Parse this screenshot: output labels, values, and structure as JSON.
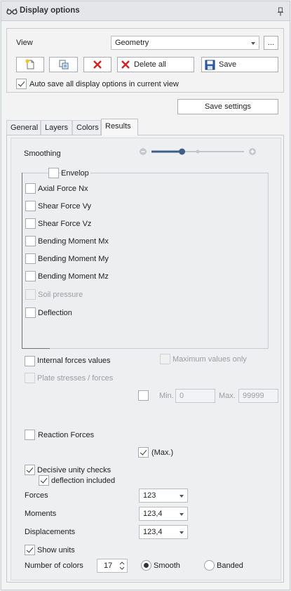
{
  "title": "Display options",
  "view": {
    "label": "View",
    "value": "Geometry",
    "more": "...",
    "buttons": {
      "delete_all": "Delete all",
      "save": "Save"
    },
    "autosave_label": "Auto save all display options in current view",
    "autosave_checked": true
  },
  "save_settings": "Save settings",
  "tabs": [
    "General",
    "Layers",
    "Colors",
    "Results"
  ],
  "active_tab": "Results",
  "results": {
    "smoothing_label": "Smoothing",
    "smoothing_level": 0.33,
    "envelop_label": "Envelop",
    "envelop_items": [
      {
        "label": "Axial Force Nx",
        "checked": false,
        "disabled": false
      },
      {
        "label": "Shear Force Vy",
        "checked": false,
        "disabled": false
      },
      {
        "label": "Shear Force Vz",
        "checked": false,
        "disabled": false
      },
      {
        "label": "Bending Moment Mx",
        "checked": false,
        "disabled": false
      },
      {
        "label": "Bending Moment My",
        "checked": false,
        "disabled": false
      },
      {
        "label": "Bending Moment Mz",
        "checked": false,
        "disabled": false
      },
      {
        "label": "Soil pressure",
        "checked": false,
        "disabled": true
      },
      {
        "label": "Deflection",
        "checked": false,
        "disabled": false
      }
    ],
    "internal_forces_values": "Internal forces values",
    "maximum_values_only": "Maximum values only",
    "plate_stresses": "Plate stresses / forces",
    "min_label": "Min.",
    "min_value": "0",
    "max_label": "Max.",
    "max_value": "99999",
    "reaction_forces": "Reaction Forces",
    "max_check_label": "(Max.)",
    "decisive_unity_checks": "Decisive unity checks",
    "deflection_included": "deflection included",
    "forces_label": "Forces",
    "forces_value": "123",
    "moments_label": "Moments",
    "moments_value": "123,4",
    "displacements_label": "Displacements",
    "displacements_value": "123,4",
    "show_units": "Show units",
    "number_of_colors_label": "Number of colors",
    "number_of_colors_value": "17",
    "smooth_label": "Smooth",
    "banded_label": "Banded",
    "coloring_mode": "Smooth"
  },
  "colors": {
    "accent": "#3f5e86",
    "delete_red": "#d32020",
    "panel_bg": "#f3f3f3"
  }
}
